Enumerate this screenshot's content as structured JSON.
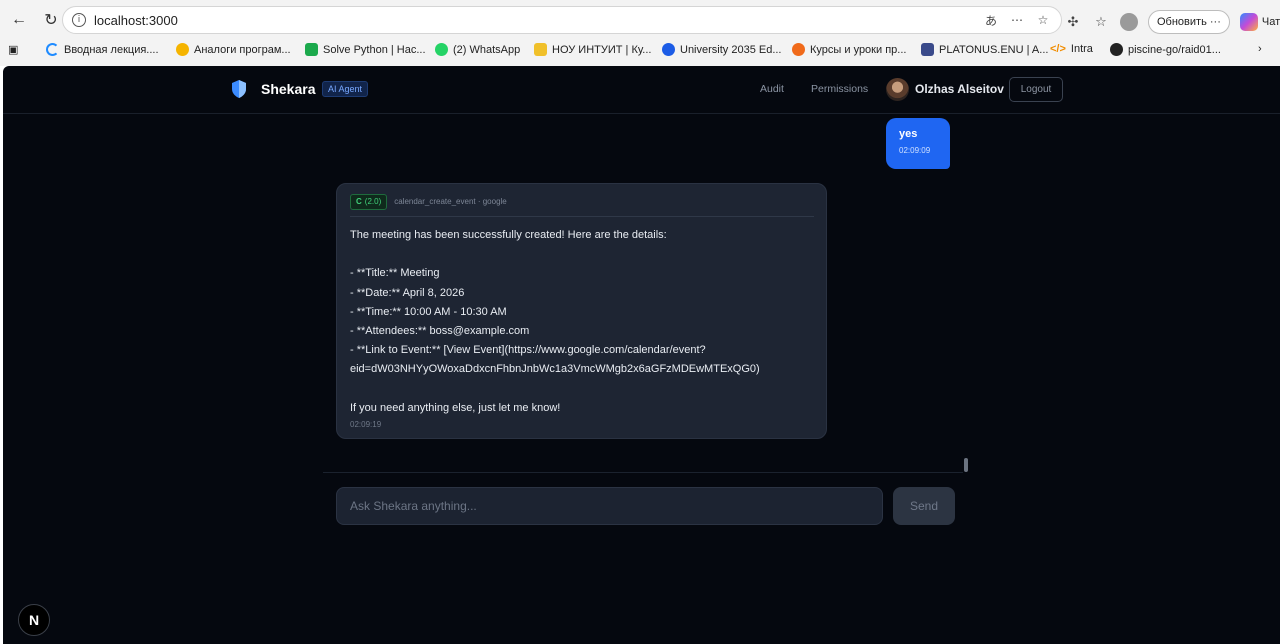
{
  "browser": {
    "url": "localhost:3000",
    "update_label": "Обновить",
    "more_label": "···",
    "chat_label": "Чат",
    "bookmarks": [
      {
        "label": "Вводная лекция....",
        "color": "#1f8bff"
      },
      {
        "label": "Аналоги програм...",
        "color": "#f5b400"
      },
      {
        "label": "Solve Python | Hac...",
        "color": "#1ba94c"
      },
      {
        "label": "(2) WhatsApp",
        "color": "#25d366"
      },
      {
        "label": "НОУ ИНТУИТ | Ку...",
        "color": "#f0c02a"
      },
      {
        "label": "University 2035 Ed...",
        "color": "#1c5ce6"
      },
      {
        "label": "Курсы и уроки пр...",
        "color": "#f06a1a"
      },
      {
        "label": "PLATONUS.ENU | A...",
        "color": "#3a4a8a"
      },
      {
        "label": "Intra",
        "color": "#f08c00"
      },
      {
        "label": "piscine-go/raid01...",
        "color": "#222222"
      }
    ]
  },
  "header": {
    "brand": "Shekara",
    "badge": "AI Agent",
    "nav": [
      "Audit",
      "Permissions"
    ],
    "user_name": "Olzhas Alseitov",
    "logout": "Logout"
  },
  "messages": {
    "user": {
      "text": "yes",
      "time": "02:09:09"
    },
    "bot": {
      "tool_badge_letter": "C",
      "tool_badge_version": "(2.0)",
      "tool_name": "calendar_create_event · google",
      "lines": [
        "The meeting has been successfully created! Here are the details:",
        "",
        "- **Title:** Meeting",
        "- **Date:** April 8, 2026",
        "- **Time:** 10:00 AM - 10:30 AM",
        "- **Attendees:** boss@example.com",
        "- **Link to Event:** [View Event](https://www.google.com/calendar/event?",
        "eid=dW03NHYyOWoxaDdxcnFhbnJnbWc1a3VmcWMgb2x6aGFzMDEwMTExQG0)",
        "",
        "If you need anything else, just let me know!"
      ],
      "time": "02:09:19"
    }
  },
  "composer": {
    "placeholder": "Ask Shekara anything...",
    "send": "Send"
  },
  "dev_badge": "N",
  "colors": {
    "app_bg": "#05080f",
    "user_bubble": "#1f66f2",
    "bot_bubble": "#1e2533",
    "tool_badge": "#41d17a",
    "ai_badge_text": "#78a8ff"
  }
}
